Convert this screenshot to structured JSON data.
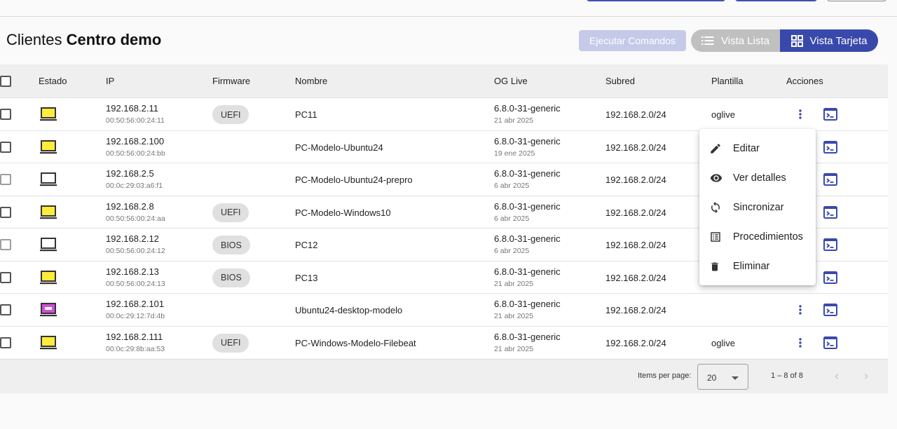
{
  "header": {
    "title_prefix": "Clientes",
    "title_center": "Centro demo"
  },
  "toolbar": {
    "execute_label": "Ejecutar Comandos",
    "list_view_label": "Vista Lista",
    "card_view_label": "Vista Tarjeta"
  },
  "table": {
    "columns": [
      "Estado",
      "IP",
      "Firmware",
      "Nombre",
      "OG Live",
      "Subred",
      "Plantilla",
      "Acciones"
    ],
    "rows": [
      {
        "status": "yellow",
        "ip": "192.168.2.11",
        "mac": "00:50:56:00:24:11",
        "firmware": "UEFI",
        "name": "PC11",
        "oglive": "6.8.0-31-generic",
        "date": "21 abr 2025",
        "subnet": "192.168.2.0/24",
        "template": "oglive"
      },
      {
        "status": "yellow",
        "ip": "192.168.2.100",
        "mac": "00:50:56:00:24:bb",
        "firmware": "",
        "name": "PC-Modelo-Ubuntu24",
        "oglive": "6.8.0-31-generic",
        "date": "19 ene 2025",
        "subnet": "192.168.2.0/24",
        "template": ""
      },
      {
        "status": "off",
        "ip": "192.168.2.5",
        "mac": "00:0c:29:03:a6:f1",
        "firmware": "",
        "name": "PC-Modelo-Ubuntu24-prepro",
        "oglive": "6.8.0-31-generic",
        "date": "6 abr 2025",
        "subnet": "192.168.2.0/24",
        "template": ""
      },
      {
        "status": "yellow",
        "ip": "192.168.2.8",
        "mac": "00:50:56:00:24:aa",
        "firmware": "UEFI",
        "name": "PC-Modelo-Windows10",
        "oglive": "6.8.0-31-generic",
        "date": "6 abr 2025",
        "subnet": "192.168.2.0/24",
        "template": ""
      },
      {
        "status": "off",
        "ip": "192.168.2.12",
        "mac": "00:50:56:00:24:12",
        "firmware": "BIOS",
        "name": "PC12",
        "oglive": "6.8.0-31-generic",
        "date": "6 abr 2025",
        "subnet": "192.168.2.0/24",
        "template": ""
      },
      {
        "status": "yellow",
        "ip": "192.168.2.13",
        "mac": "00:50:56:00:24:13",
        "firmware": "BIOS",
        "name": "PC13",
        "oglive": "6.8.0-31-generic",
        "date": "21 abr 2025",
        "subnet": "192.168.2.0/24",
        "template": ""
      },
      {
        "status": "magenta",
        "ip": "192.168.2.101",
        "mac": "00:0c:29:12:7d:4b",
        "firmware": "",
        "name": "Ubuntu24-desktop-modelo",
        "oglive": "6.8.0-31-generic",
        "date": "21 abr 2025",
        "subnet": "192.168.2.0/24",
        "template": ""
      },
      {
        "status": "yellow",
        "ip": "192.168.2.111",
        "mac": "00:0c:29:8b:aa:53",
        "firmware": "UEFI",
        "name": "PC-Windows-Modelo-Filebeat",
        "oglive": "6.8.0-31-generic",
        "date": "21 abr 2025",
        "subnet": "192.168.2.0/24",
        "template": "oglive"
      }
    ]
  },
  "paginator": {
    "items_per_page_label": "Items per page:",
    "page_size": "20",
    "range": "1 – 8 of 8"
  },
  "context_menu": {
    "items": [
      {
        "label": "Editar",
        "icon": "pencil-icon"
      },
      {
        "label": "Ver detalles",
        "icon": "eye-icon"
      },
      {
        "label": "Sincronizar",
        "icon": "sync-icon"
      },
      {
        "label": "Procedimientos",
        "icon": "list-icon"
      },
      {
        "label": "Eliminar",
        "icon": "trash-icon"
      }
    ]
  },
  "colors": {
    "accent": "#3949ab",
    "status_yellow": "#ffeb3b",
    "status_magenta": "#d04fd8",
    "status_off": "#ffffff"
  }
}
